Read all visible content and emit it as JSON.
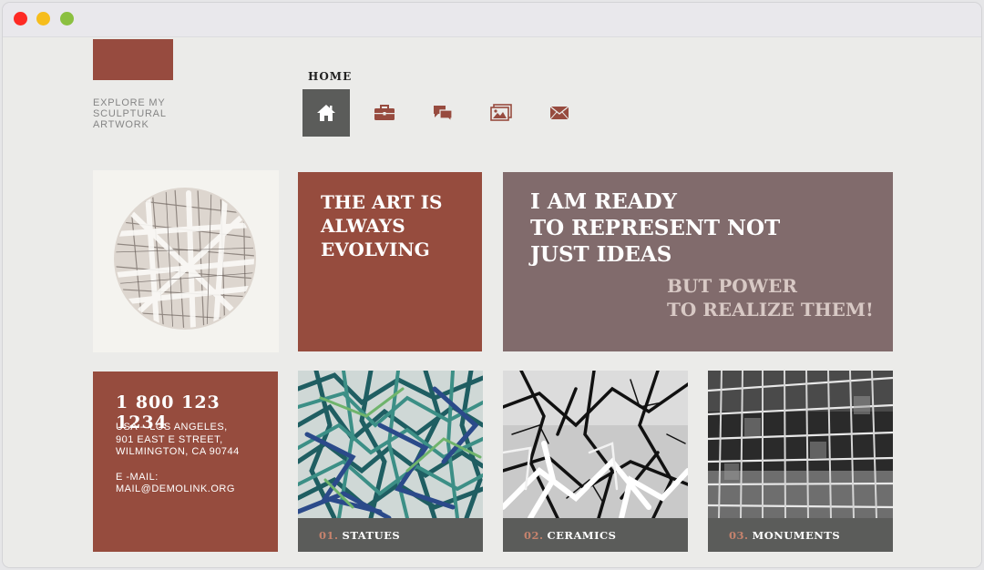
{
  "window": {
    "controls": [
      "close",
      "minimize",
      "maximize"
    ]
  },
  "brand": {
    "tagline": "EXPLORE MY\nSCULPTURAL\nARTWORK"
  },
  "nav": {
    "active_label": "HOME",
    "items": [
      {
        "icon": "home-icon",
        "active": true
      },
      {
        "icon": "briefcase-icon",
        "active": false
      },
      {
        "icon": "chat-bubbles-icon",
        "active": false
      },
      {
        "icon": "gallery-icon",
        "active": false
      },
      {
        "icon": "envelope-icon",
        "active": false
      }
    ]
  },
  "promo": {
    "text": "THE ART IS\nALWAYS\nEVOLVING"
  },
  "statement": {
    "main": "I AM READY\nTO REPRESENT NOT\nJUST IDEAS",
    "sub": "BUT POWER\nTO REALIZE THEM!"
  },
  "contact": {
    "phone": "1 800 123 1234",
    "address": "USA – LOS ANGELES,\n901 EAST E STREET,\nWILMINGTON, CA 90744",
    "email": "E -MAIL:\nMAIL@DEMOLINK.ORG"
  },
  "gallery": [
    {
      "num": "01.",
      "name": "STATUES"
    },
    {
      "num": "02.",
      "name": "CERAMICS"
    },
    {
      "num": "03.",
      "name": "MONUMENTS"
    }
  ],
  "colors": {
    "brand_red": "#964c3e",
    "mauve": "#816b6c",
    "dark_gray": "#5b5c5a",
    "caption_number": "#c6836d",
    "background": "#ebebe9"
  }
}
